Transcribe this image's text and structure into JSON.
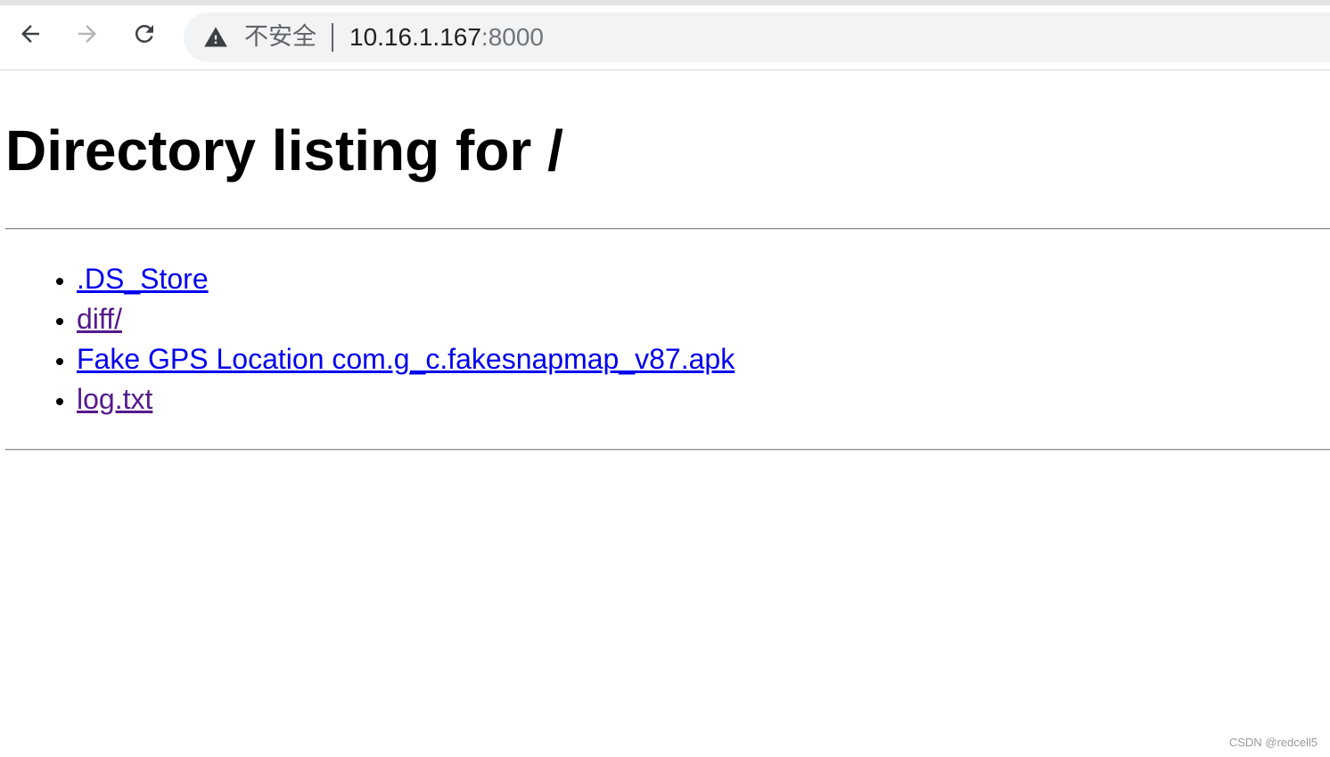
{
  "browser": {
    "security_label": "不安全",
    "url_host": "10.16.1.167",
    "url_port": ":8000",
    "icons": {
      "back": "arrow-left-icon",
      "forward": "arrow-right-icon",
      "reload": "reload-icon",
      "security": "warning-triangle-icon"
    }
  },
  "page": {
    "title": "Directory listing for /",
    "entries": [
      {
        "label": ".DS_Store",
        "visited": false
      },
      {
        "label": "diff/",
        "visited": true
      },
      {
        "label": "Fake GPS Location com.g_c.fakesnapmap_v87.apk",
        "visited": false
      },
      {
        "label": "log.txt",
        "visited": true
      }
    ]
  },
  "watermark": "CSDN @redcell5",
  "colors": {
    "link": "#0000ee",
    "visited_link": "#551a8b"
  }
}
